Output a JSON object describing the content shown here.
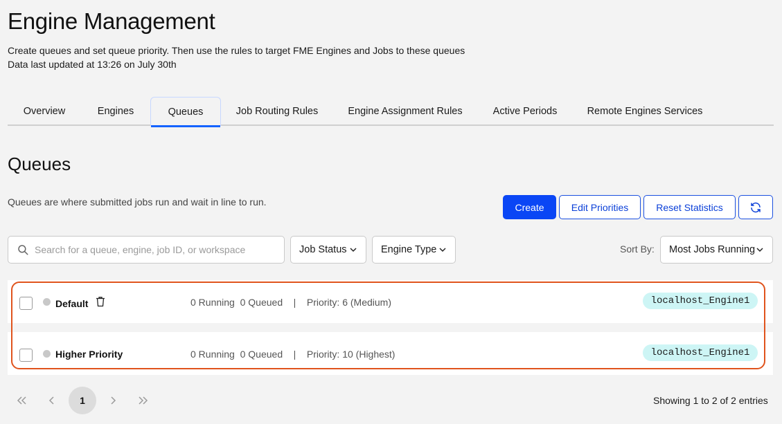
{
  "header": {
    "title": "Engine Management",
    "description": "Create queues and set queue priority. Then use the rules to target FME Engines and Jobs to these queues",
    "updated": "Data last updated at 13:26 on July 30th"
  },
  "tabs": [
    {
      "label": "Overview"
    },
    {
      "label": "Engines"
    },
    {
      "label": "Queues",
      "active": true
    },
    {
      "label": "Job Routing Rules"
    },
    {
      "label": "Engine Assignment Rules"
    },
    {
      "label": "Active Periods"
    },
    {
      "label": "Remote Engines Services"
    }
  ],
  "queues_section": {
    "title": "Queues",
    "description": "Queues are where submitted jobs run and wait in line to run.",
    "create_label": "Create",
    "edit_priorities_label": "Edit Priorities",
    "reset_statistics_label": "Reset Statistics",
    "refresh_icon": "refresh-icon"
  },
  "filters": {
    "search_placeholder": "Search for a queue, engine, job ID, or workspace",
    "job_status_label": "Job Status",
    "engine_type_label": "Engine Type",
    "sort_by_label": "Sort By:",
    "sort_value": "Most Jobs Running"
  },
  "queues": [
    {
      "name": "Default",
      "running": "0 Running",
      "queued": "0 Queued",
      "separator": "|",
      "priority": "Priority: 6 (Medium)",
      "engine": "localhost_Engine1",
      "status_color": "#c8c8c8"
    },
    {
      "name": "Higher Priority",
      "running": "0 Running",
      "queued": "0 Queued",
      "separator": "|",
      "priority": "Priority: 10 (Highest)",
      "engine": "localhost_Engine1",
      "status_color": "#c8c8c8"
    }
  ],
  "pagination": {
    "current_page": "1",
    "showing": "Showing 1 to 2 of 2 entries"
  },
  "colors": {
    "primary": "#0a46f5",
    "highlight": "#e0531c",
    "engine_tag": "#cdf5f5"
  }
}
